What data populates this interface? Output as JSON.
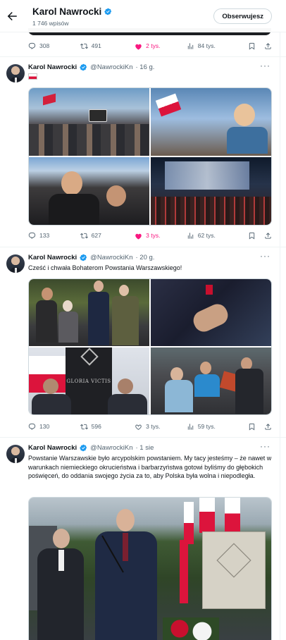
{
  "header": {
    "name": "Karol Nawrocki",
    "post_count": "1 746 wpisów",
    "follow_label": "Obserwujesz"
  },
  "prev_actions": {
    "replies": "308",
    "retweets": "491",
    "likes": "2 tys.",
    "views": "84 tys."
  },
  "tweets": [
    {
      "name": "Karol Nawrocki",
      "handle": "@NawrockiKn",
      "time": "· 16 g.",
      "text": "",
      "flag": "🇵🇱",
      "replies": "133",
      "retweets": "627",
      "likes": "3 tys.",
      "views": "62 tys."
    },
    {
      "name": "Karol Nawrocki",
      "handle": "@NawrockiKn",
      "time": "· 20 g.",
      "text": "Cześć i chwała Bohaterom Powstania Warszawskiego!",
      "replies": "130",
      "retweets": "596",
      "likes": "3 tys.",
      "views": "59 tys."
    },
    {
      "name": "Karol Nawrocki",
      "handle": "@NawrockiKn",
      "time": "· 1 sie",
      "text": "Powstanie Warszawskie było arcypolskim powstaniem. My tacy jesteśmy – że nawet w warunkach niemieckiego okrucieństwa i barbarzyństwa gotowi byliśmy do głębokich poświęceń, do oddania swojego życia za to, aby Polska była wolna i niepodległa."
    }
  ],
  "photo_text": {
    "gloria": "GLORIA VICTIS"
  },
  "icons": [
    "back-arrow-icon",
    "verified-badge-icon",
    "reply-icon",
    "retweet-icon",
    "like-icon",
    "views-icon",
    "bookmark-icon",
    "share-icon",
    "more-icon"
  ],
  "colors": {
    "verified": "#1d9bf0",
    "like": "#f91880",
    "muted": "#536471"
  }
}
